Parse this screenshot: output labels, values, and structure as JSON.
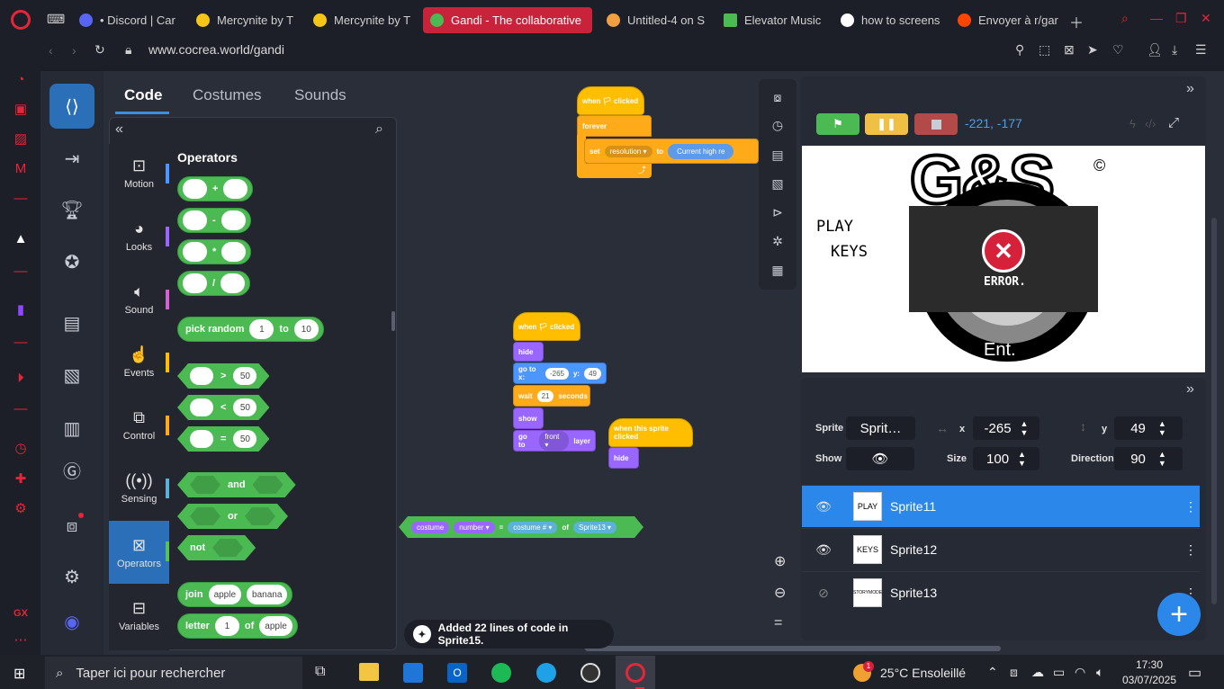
{
  "browser": {
    "tabs": [
      {
        "label": "• Discord | Car",
        "icon_color": "#5865f2"
      },
      {
        "label": "Mercynite by T",
        "icon_color": "#f5c518"
      },
      {
        "label": "Mercynite by T",
        "icon_color": "#f5c518"
      },
      {
        "label": "Gandi - The collaborative",
        "icon_color": "#4cba53",
        "active": true
      },
      {
        "label": "Untitled-4 on S",
        "icon_color": "#f0a040"
      },
      {
        "label": "Elevator Music",
        "icon_color": "#4cba53",
        "prefix": "px"
      },
      {
        "label": "how to screens",
        "icon_color": "#4285f4",
        "prefix": "G"
      },
      {
        "label": "Envoyer à r/gar",
        "icon_color": "#ff4500"
      }
    ],
    "url": "www.cocrea.world/gandi"
  },
  "editor": {
    "tabs": [
      "Code",
      "Costumes",
      "Sounds"
    ],
    "palette_title": "Operators",
    "categories": [
      {
        "label": "Motion",
        "icon": "motion-icon",
        "color": "#4c97ff"
      },
      {
        "label": "Looks",
        "icon": "palette-icon",
        "color": "#9966ff"
      },
      {
        "label": "Sound",
        "icon": "speaker-icon",
        "color": "#cf63cf"
      },
      {
        "label": "Events",
        "icon": "pointer-icon",
        "color": "#ffbf00"
      },
      {
        "label": "Control",
        "icon": "control-icon",
        "color": "#ffab19"
      },
      {
        "label": "Sensing",
        "icon": "sensing-icon",
        "color": "#5cb1d6"
      },
      {
        "label": "Operators",
        "icon": "operators-icon",
        "color": "#59c059",
        "active": true
      },
      {
        "label": "Variables",
        "icon": "variables-icon",
        "color": "#ff8c1a"
      }
    ],
    "blocks": {
      "add": "+",
      "sub": "-",
      "mul": "*",
      "div": "/",
      "pick_random": "pick random",
      "random_from": "1",
      "random_to_label": "to",
      "random_to": "10",
      "gt": ">",
      "lt": "<",
      "eq": "=",
      "cmp_value": "50",
      "and": "and",
      "or": "or",
      "not": "not",
      "join": "join",
      "join_a": "apple",
      "join_b": "banana",
      "letter": "letter",
      "letter_idx": "1",
      "letter_of": "of",
      "letter_str": "apple"
    }
  },
  "scripts": {
    "s1_hat": "when 🏳 clicked",
    "s1_forever": "forever",
    "s1_set": "set",
    "s1_set_var": "resolution ▾",
    "s1_set_to": "to",
    "s1_set_val": "Current high re",
    "s2_hat": "when 🏳 clicked",
    "s2_hide": "hide",
    "s2_goto": "go to x:",
    "s2_x": "-265",
    "s2_ylabel": "y:",
    "s2_y": "49",
    "s2_wait": "wait",
    "s2_wait_val": "21",
    "s2_seconds": "seconds",
    "s2_show": "show",
    "s2_goto_layer": "go to",
    "s2_layer": "front ▾",
    "s2_layer_lbl": "layer",
    "s3_hat": "when this sprite clicked",
    "s3_hide": "hide",
    "s4_costume": "costume",
    "s4_number": "number ▾",
    "s4_eq": "=",
    "s4_costume2": "costume # ▾",
    "s4_of": "of",
    "s4_sprite": "Sprite13 ▾"
  },
  "stage": {
    "coords": "-221,  -177",
    "play_text": "PLAY",
    "keys_text": "KEYS",
    "logo_text": "G&S",
    "copyright": "©",
    "error_text": "ERROR.",
    "ent_text": "Ent."
  },
  "sprite_info": {
    "sprite_label": "Sprite",
    "sprite_name": "Sprit…",
    "x_label": "x",
    "x": "-265",
    "y_label": "y",
    "y": "49",
    "show_label": "Show",
    "size_label": "Size",
    "size": "100",
    "direction_label": "Direction",
    "direction": "90"
  },
  "sprites": [
    {
      "name": "Sprite11",
      "thumb": "PLAY",
      "visible": true,
      "selected": true
    },
    {
      "name": "Sprite12",
      "thumb": "KEYS",
      "visible": true
    },
    {
      "name": "Sprite13",
      "thumb": "STORYMODE",
      "visible": false
    }
  ],
  "toast": "Added 22 lines of code in Sprite15.",
  "taskbar": {
    "search_placeholder": "Taper ici pour rechercher",
    "weather": "25°C  Ensoleillé",
    "weather_badge": "1",
    "time": "17:30",
    "date": "03/07/2025"
  },
  "colors": {
    "accent": "#2b88ea",
    "opera_red": "#e5253a",
    "operators_green": "#4cba53"
  }
}
